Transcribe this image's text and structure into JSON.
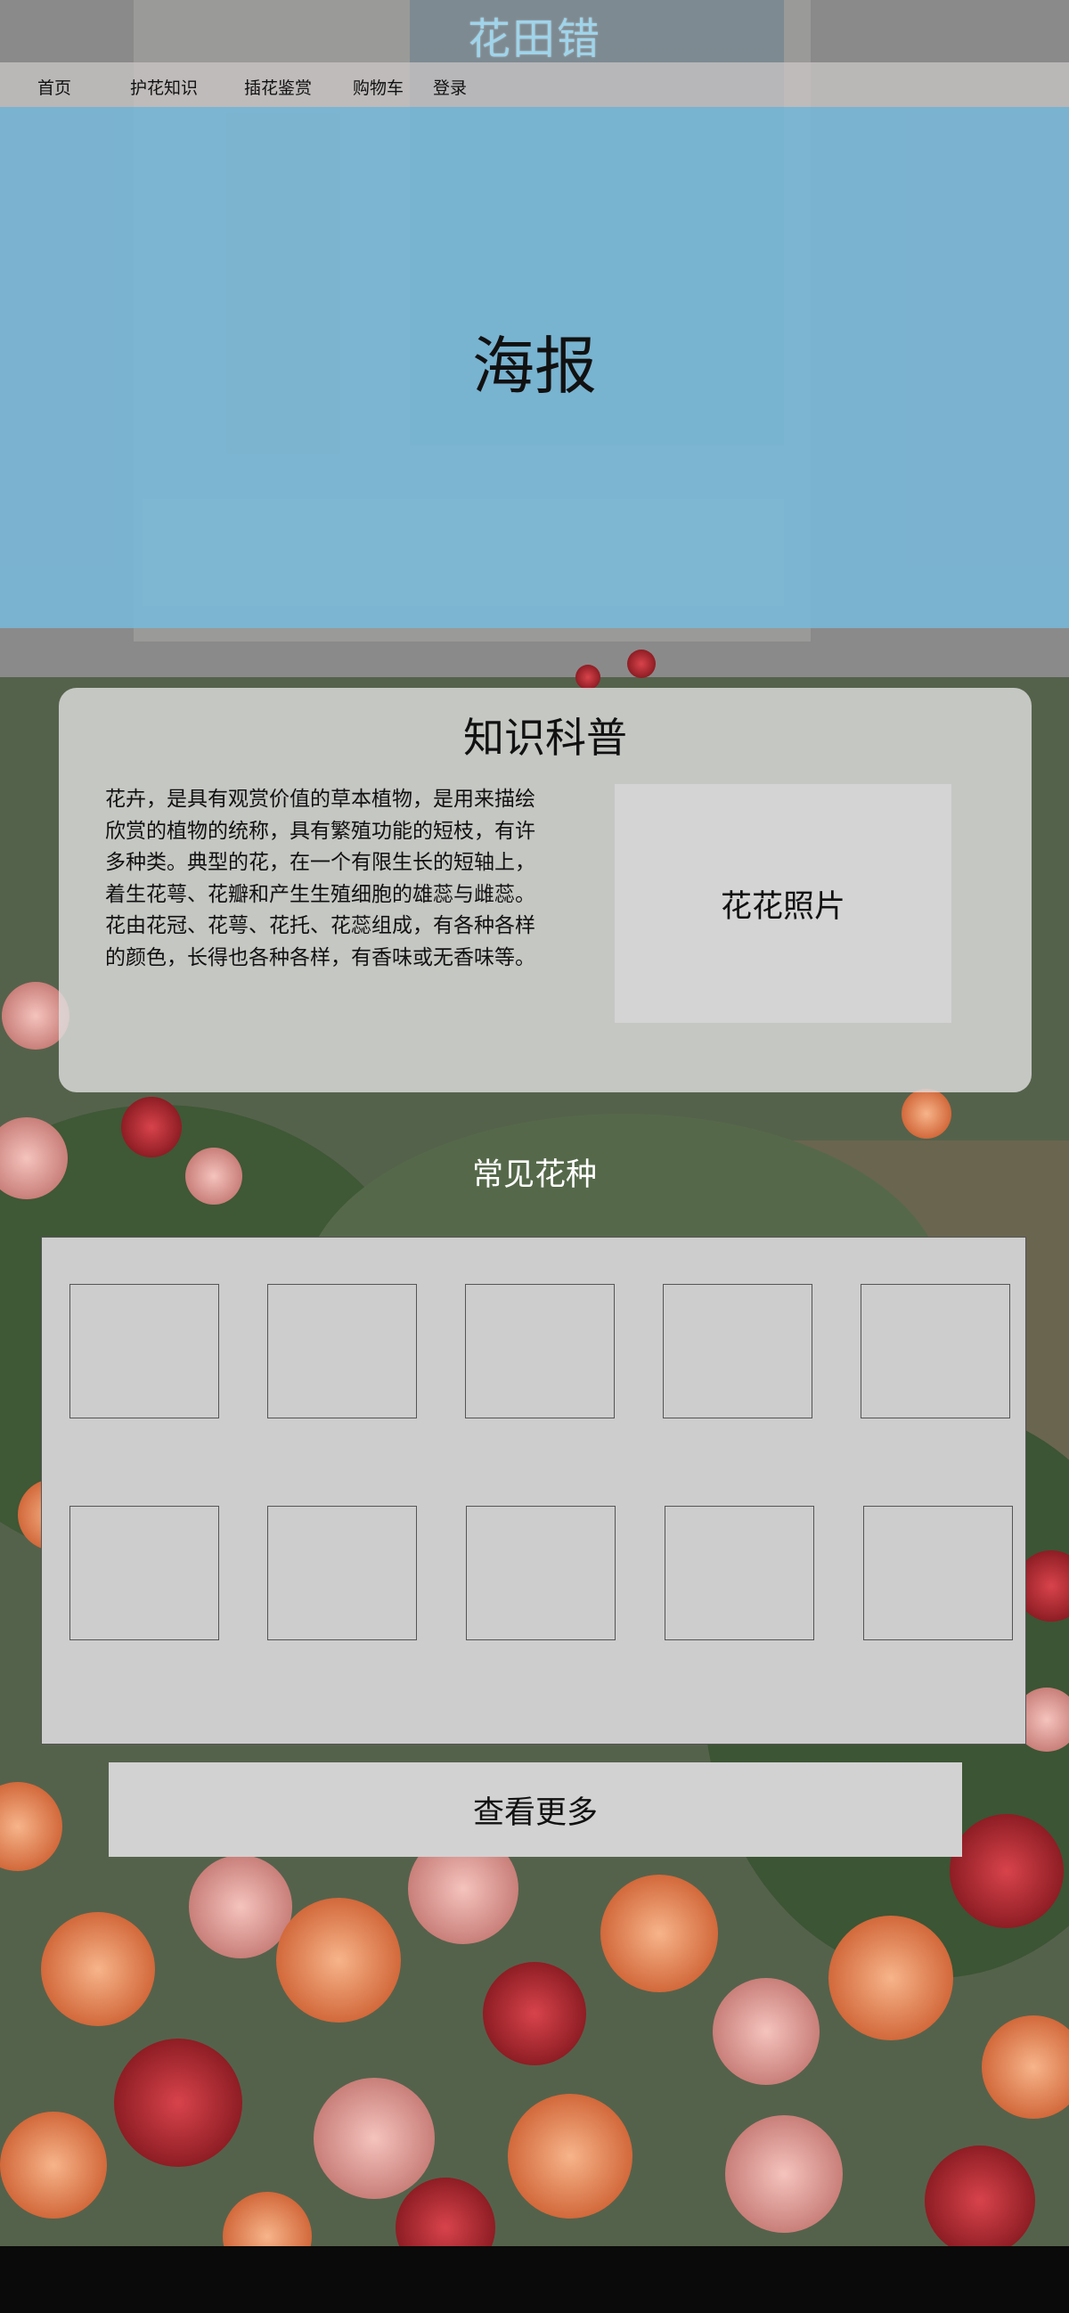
{
  "site": {
    "title": "花田错"
  },
  "nav": {
    "items": [
      {
        "label": "首页"
      },
      {
        "label": "护花知识"
      },
      {
        "label": "插花鉴赏"
      },
      {
        "label": "购物车"
      },
      {
        "label": "登录"
      }
    ]
  },
  "banner": {
    "label": "海报"
  },
  "knowledge": {
    "title": "知识科普",
    "text": "花卉，是具有观赏价值的草本植物，是用来描绘欣赏的植物的统称，具有繁殖功能的短枝，有许多种类。典型的花，在一个有限生长的短轴上，着生花萼、花瓣和产生生殖细胞的雄蕊与雌蕊。花由花冠、花萼、花托、花蕊组成，有各种各样的颜色，长得也各种各样，有香味或无香味等。",
    "photo_label": "花花照片"
  },
  "common_flowers": {
    "title": "常见花种",
    "more_button": "查看更多"
  },
  "colors": {
    "banner": "#78b8d8",
    "title": "#9fd4ea",
    "panel": "#cdcdcd"
  }
}
